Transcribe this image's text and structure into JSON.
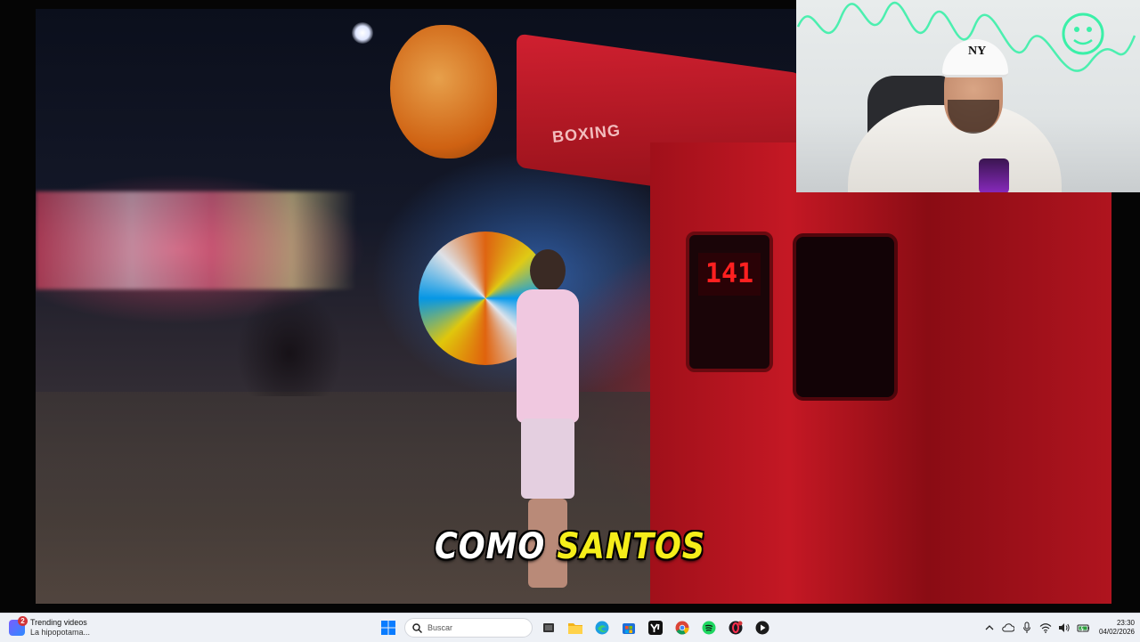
{
  "video": {
    "subtitle_word1": "COMO",
    "subtitle_word2": "SANTOS",
    "machine_label": "BOXING",
    "score_display": "141"
  },
  "webcam": {
    "cap_logo": "NY"
  },
  "taskbar": {
    "widget": {
      "badge_count": "2",
      "title": "Trending videos",
      "subtitle": "La hipopotama..."
    },
    "search": {
      "placeholder": "Buscar"
    },
    "apps": [
      {
        "name": "start-icon"
      },
      {
        "name": "search-icon"
      },
      {
        "name": "task-view-icon"
      },
      {
        "name": "file-explorer-icon"
      },
      {
        "name": "edge-icon"
      },
      {
        "name": "store-icon"
      },
      {
        "name": "yahoo-icon"
      },
      {
        "name": "chrome-icon"
      },
      {
        "name": "spotify-icon"
      },
      {
        "name": "opera-gx-icon"
      },
      {
        "name": "media-player-icon"
      }
    ],
    "tray": {
      "time": "23:30",
      "date": "04/02/2026"
    }
  },
  "colors": {
    "subtitle_white": "#ffffff",
    "subtitle_yellow": "#f5ee1a",
    "neon_green": "#3bf0a8",
    "taskbar_bg": "#eef1f6"
  }
}
